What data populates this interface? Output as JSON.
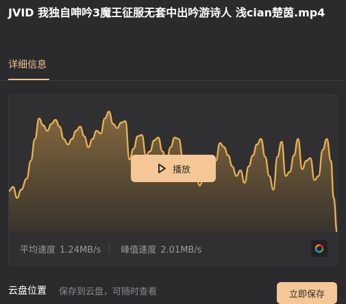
{
  "header": {
    "title": "JVID 我独自呻吟3魔王征服无套中出吟游诗人 浅cian楚茵.mp4"
  },
  "tabs": [
    {
      "label": "详细信息",
      "active": true
    }
  ],
  "player": {
    "play_label": "播放"
  },
  "stats": {
    "avg_label": "平均速度",
    "avg_value": "1.24MB/s",
    "peak_label": "峰值速度",
    "peak_value": "2.01MB/s"
  },
  "cloud": {
    "label": "云盘位置",
    "hint": "保存到云盘，可随时查看",
    "save_label": "立即保存"
  },
  "icons": {
    "play": "play-icon",
    "settings": "color-ring-icon"
  },
  "colors": {
    "accent": "#f5c796",
    "tab_accent": "#f0c28a",
    "wave": "#e8b04e"
  }
}
